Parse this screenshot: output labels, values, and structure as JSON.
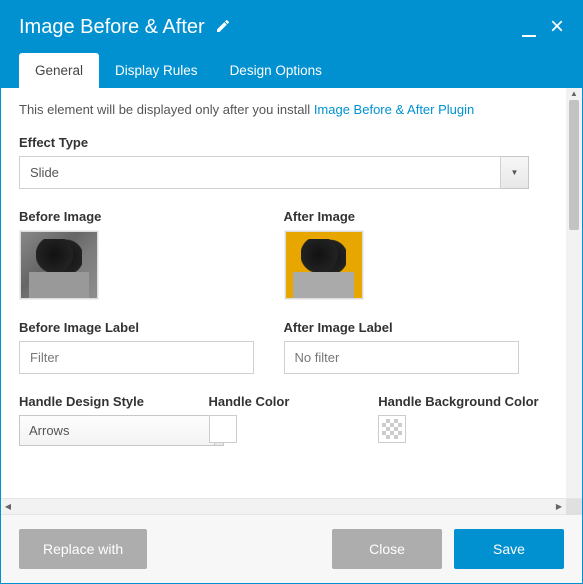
{
  "header": {
    "title": "Image Before & After"
  },
  "tabs": {
    "general": "General",
    "display_rules": "Display Rules",
    "design_options": "Design Options"
  },
  "notice": {
    "prefix": "This element will be displayed only after you install ",
    "link": "Image Before & After Plugin"
  },
  "effect_type": {
    "label": "Effect Type",
    "value": "Slide"
  },
  "before_image": {
    "label": "Before Image"
  },
  "after_image": {
    "label": "After Image"
  },
  "before_label": {
    "label": "Before Image Label",
    "value": "Filter"
  },
  "after_label": {
    "label": "After Image Label",
    "value": "No filter"
  },
  "handle_style": {
    "label": "Handle Design Style",
    "value": "Arrows"
  },
  "handle_color": {
    "label": "Handle Color",
    "value": "#ffffff"
  },
  "handle_bg": {
    "label": "Handle Background Color",
    "value": "transparent"
  },
  "footer": {
    "replace": "Replace with",
    "close": "Close",
    "save": "Save"
  }
}
